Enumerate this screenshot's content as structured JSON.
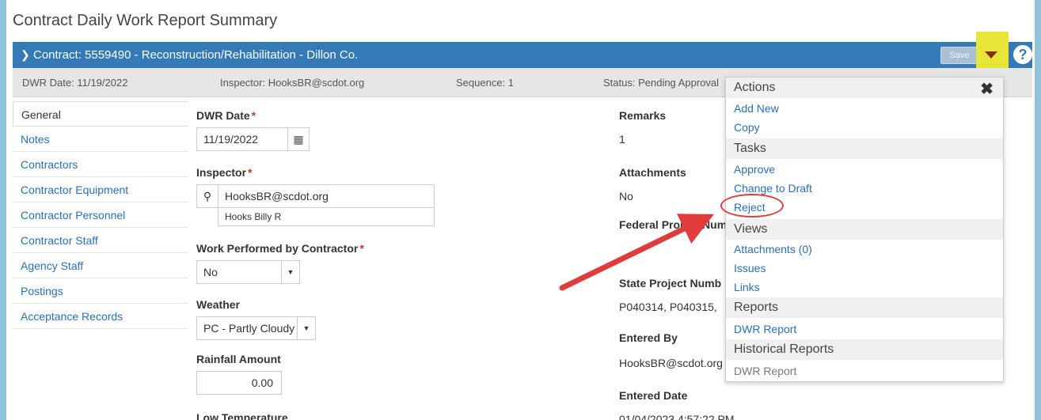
{
  "page_title": "Contract Daily Work Report Summary",
  "contract_bar": {
    "title": "Contract: 5559490 - Reconstruction/Rehabilitation - Dillon Co.",
    "save_label": "Save",
    "help": "?"
  },
  "info": {
    "date": "DWR Date: 11/19/2022",
    "inspector": "Inspector: HooksBR@scdot.org",
    "sequence": "Sequence: 1",
    "status": "Status: Pending Approval"
  },
  "sidebar": {
    "items": [
      {
        "label": "General"
      },
      {
        "label": "Notes"
      },
      {
        "label": "Contractors"
      },
      {
        "label": "Contractor Equipment"
      },
      {
        "label": "Contractor Personnel"
      },
      {
        "label": "Contractor Staff"
      },
      {
        "label": "Agency Staff"
      },
      {
        "label": "Postings"
      },
      {
        "label": "Acceptance Records"
      }
    ]
  },
  "form": {
    "dwr_date_label": "DWR Date",
    "dwr_date_value": "11/19/2022",
    "inspector_label": "Inspector",
    "inspector_value": "HooksBR@scdot.org",
    "inspector_name": "Hooks Billy R",
    "work_label": "Work Performed by Contractor",
    "work_value": "No",
    "weather_label": "Weather",
    "weather_value": "PC - Partly Cloudy",
    "rainfall_label": "Rainfall Amount",
    "rainfall_value": "0.00",
    "low_temp_label": "Low Temperature",
    "required_mark": "*"
  },
  "right_col": {
    "remarks_label": "Remarks",
    "remarks_value": "1",
    "attachments_label": "Attachments",
    "attachments_value": "No",
    "federal_label": "Federal Project Num",
    "state_label": "State Project Numb",
    "state_value": "P040314, P040315,",
    "entered_by_label": "Entered By",
    "entered_by_value": "HooksBR@scdot.org",
    "entered_date_label": "Entered Date",
    "entered_date_value": "01/04/2023 4:57:22 PM"
  },
  "menu": {
    "actions_header": "Actions",
    "add_new": "Add New",
    "copy": "Copy",
    "tasks_header": "Tasks",
    "approve": "Approve",
    "change_to_draft": "Change to Draft",
    "reject": "Reject",
    "views_header": "Views",
    "attachments": "Attachments (0)",
    "issues": "Issues",
    "links": "Links",
    "reports_header": "Reports",
    "dwr_report": "DWR Report",
    "historical_header": "Historical Reports",
    "hist_dwr_report": "DWR Report"
  },
  "colors": {
    "bar": "#337ab7",
    "link": "#2a6eb5",
    "highlight": "#e7e636",
    "annotation": "#e03c3c"
  }
}
